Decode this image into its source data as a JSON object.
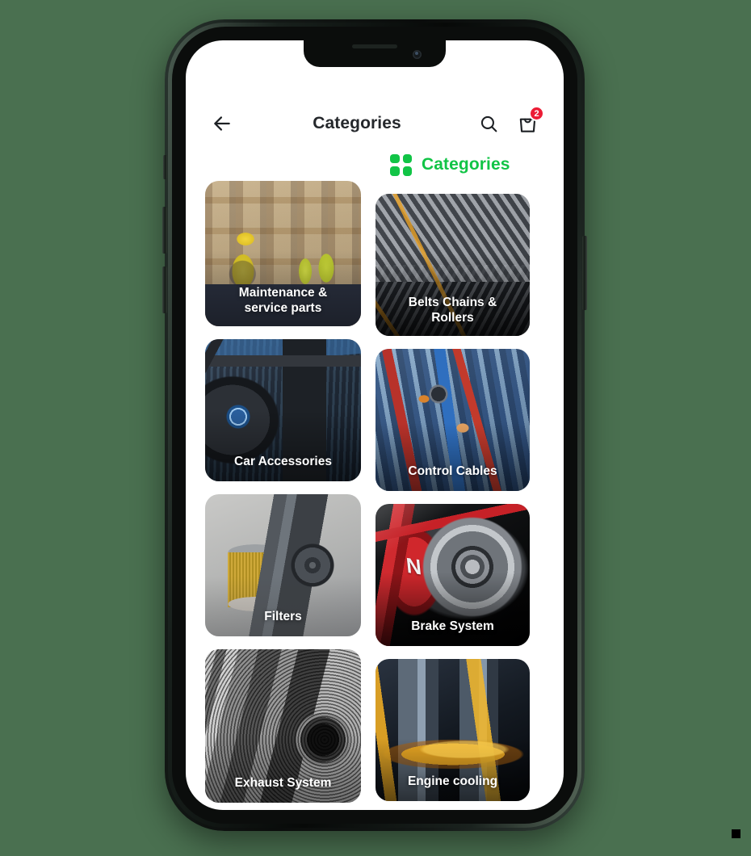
{
  "background_color": "#4a7050",
  "device": {
    "name": "smartphone-mockup",
    "frame_color": "#0b0d0c",
    "buttons": [
      "mute-switch",
      "volume-up",
      "volume-down",
      "power"
    ]
  },
  "appbar": {
    "back_icon": "arrow-left-icon",
    "title": "Categories",
    "search_icon": "search-icon",
    "cart_icon": "shopping-bag-icon",
    "cart_badge": "2",
    "badge_color": "#ec1c35",
    "title_color": "#25282c"
  },
  "section": {
    "icon": "grid-icon",
    "title": "Categories",
    "accent_color": "#11c446"
  },
  "columns": {
    "left": [
      {
        "label": "Maintenance &\nservice parts",
        "line1": "Maintenance &",
        "line2": "service parts",
        "art": "warehouse-workers",
        "height": "tall"
      },
      {
        "label": "Car Accessories",
        "art": "car-interior-bmw-steering-wheel",
        "height": "mid"
      },
      {
        "label": "Filters",
        "art": "oil-filters",
        "height": "mid"
      },
      {
        "label": "Exhaust System",
        "art": "chrome-exhaust-tip",
        "height": "lg"
      }
    ],
    "right": [
      {
        "label": "Belts Chains &\nRollers",
        "line1": "Belts Chains &",
        "line2": "Rollers",
        "art": "timing-chains",
        "height": "mid"
      },
      {
        "label": "Control Cables",
        "art": "colored-electrical-cables",
        "height": "mid"
      },
      {
        "label": "Brake System",
        "art": "red-brake-caliper-rotor",
        "badge_text": "N",
        "height": "mid"
      },
      {
        "label": "Engine cooling",
        "art": "pistons-oil-splash",
        "height": "mid"
      }
    ]
  }
}
